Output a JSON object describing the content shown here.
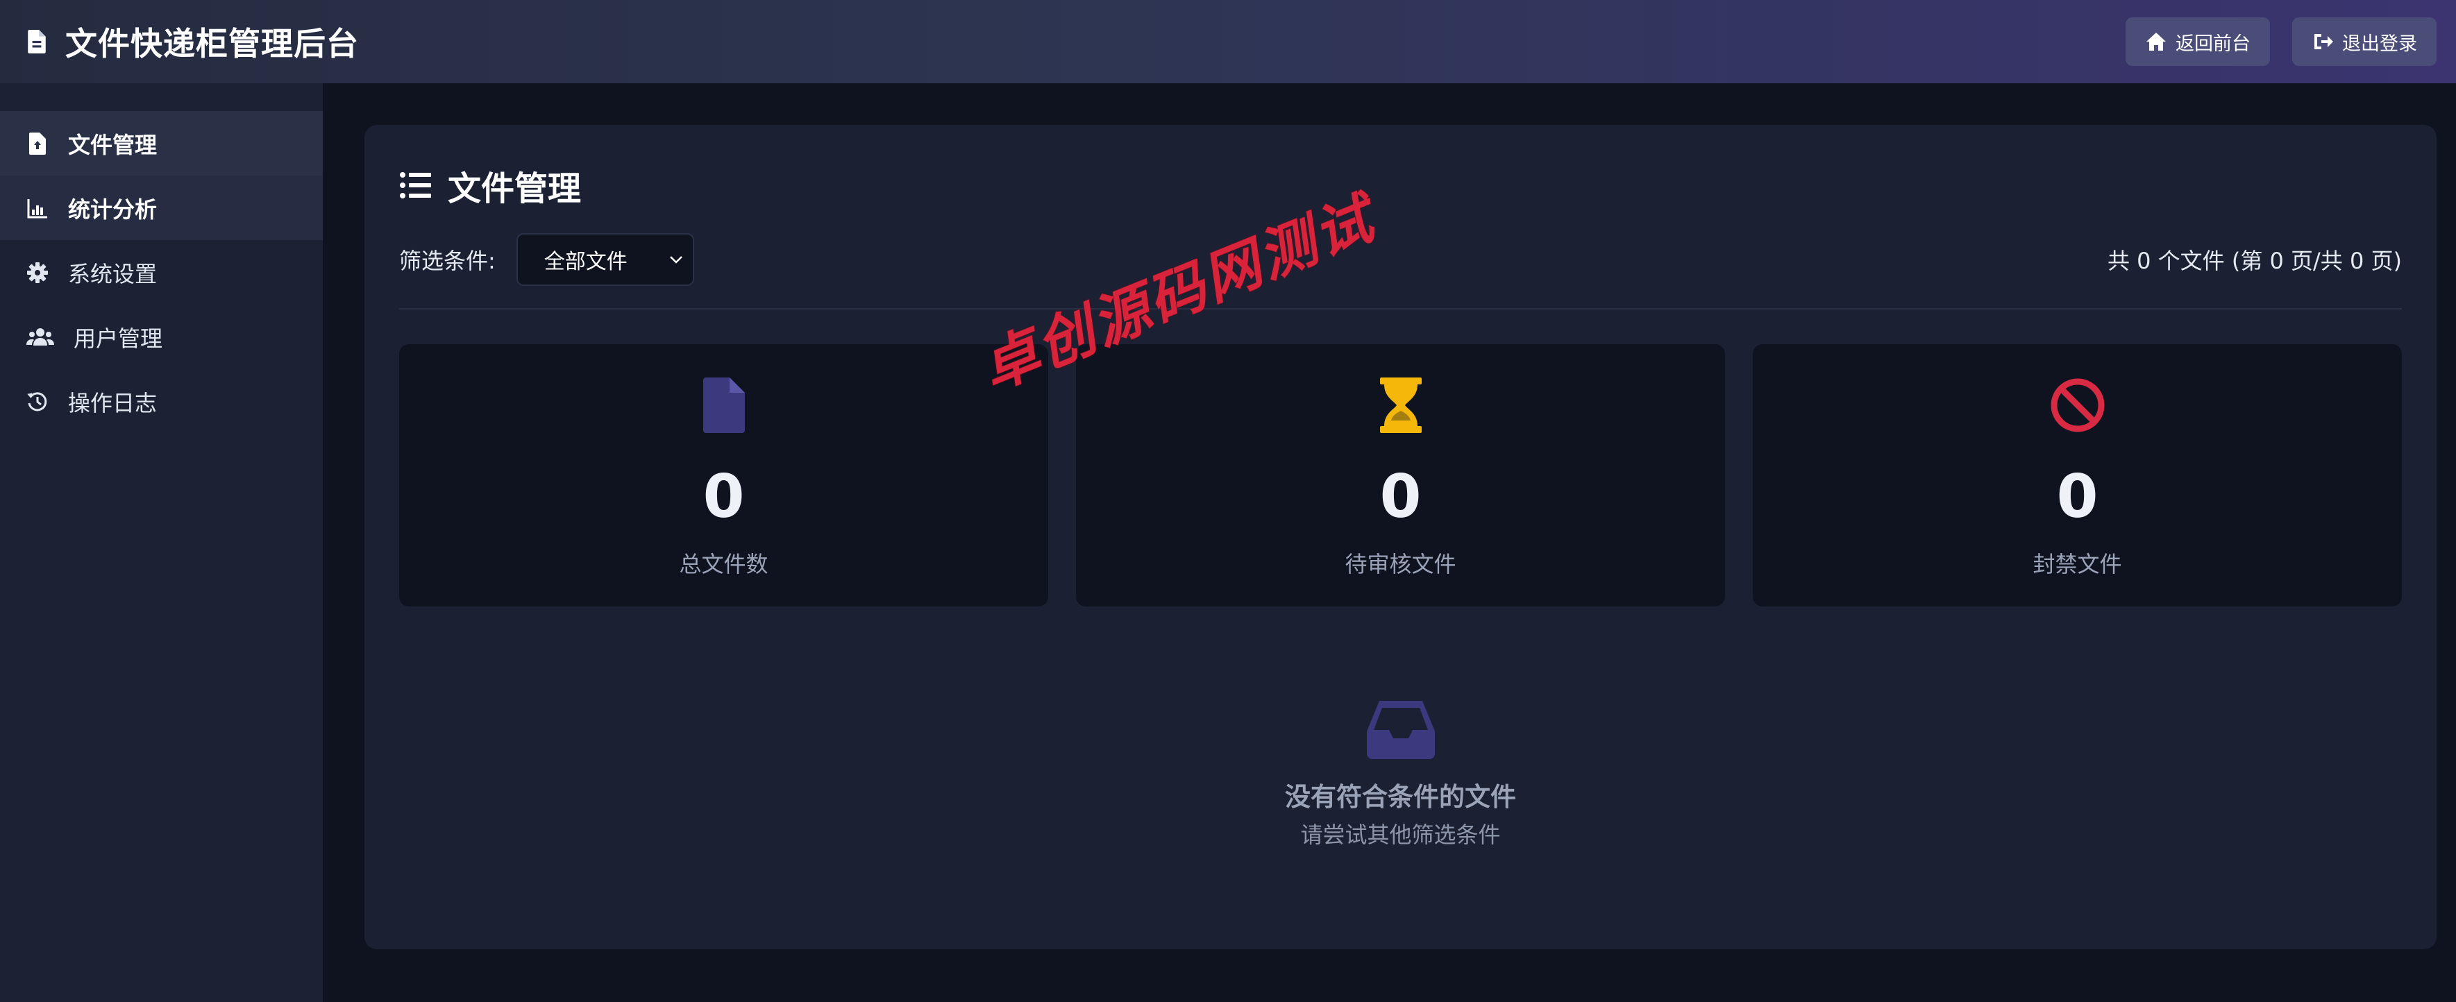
{
  "header": {
    "title": "文件快递柜管理后台",
    "logo_icon": "file-icon",
    "buttons": [
      {
        "label": "返回前台",
        "icon": "home-icon"
      },
      {
        "label": "退出登录",
        "icon": "logout-icon"
      }
    ]
  },
  "sidebar": {
    "items": [
      {
        "label": "文件管理",
        "icon": "file-icon",
        "state": "active"
      },
      {
        "label": "统计分析",
        "icon": "chart-icon",
        "state": "hover"
      },
      {
        "label": "系统设置",
        "icon": "gear-icon",
        "state": ""
      },
      {
        "label": "用户管理",
        "icon": "users-icon",
        "state": ""
      },
      {
        "label": "操作日志",
        "icon": "history-icon",
        "state": ""
      }
    ]
  },
  "main": {
    "title": "文件管理",
    "title_icon": "list-icon",
    "filter": {
      "label": "筛选条件:",
      "selected": "全部文件"
    },
    "count_text": "共 0 个文件 (第 0 页/共 0 页)",
    "stats": [
      {
        "value": "0",
        "label": "总文件数",
        "icon": "file-icon",
        "color": "#3c3a7e"
      },
      {
        "value": "0",
        "label": "待审核文件",
        "icon": "hourglass-icon",
        "color": "#f5b70a"
      },
      {
        "value": "0",
        "label": "封禁文件",
        "icon": "ban-icon",
        "color": "#d92a44"
      }
    ],
    "empty": {
      "icon": "inbox-icon",
      "title": "没有符合条件的文件",
      "subtitle": "请尝试其他筛选条件"
    }
  },
  "watermark": "卓创源码网测试",
  "colors": {
    "header_gradient_start": "#252b3f",
    "header_gradient_end": "#3b3470",
    "sidebar_bg": "#1c2233",
    "panel_bg": "#1b2133",
    "card_bg": "#0f1320",
    "accent_purple": "#3c3a7e",
    "watermark_red": "#d8233a"
  }
}
